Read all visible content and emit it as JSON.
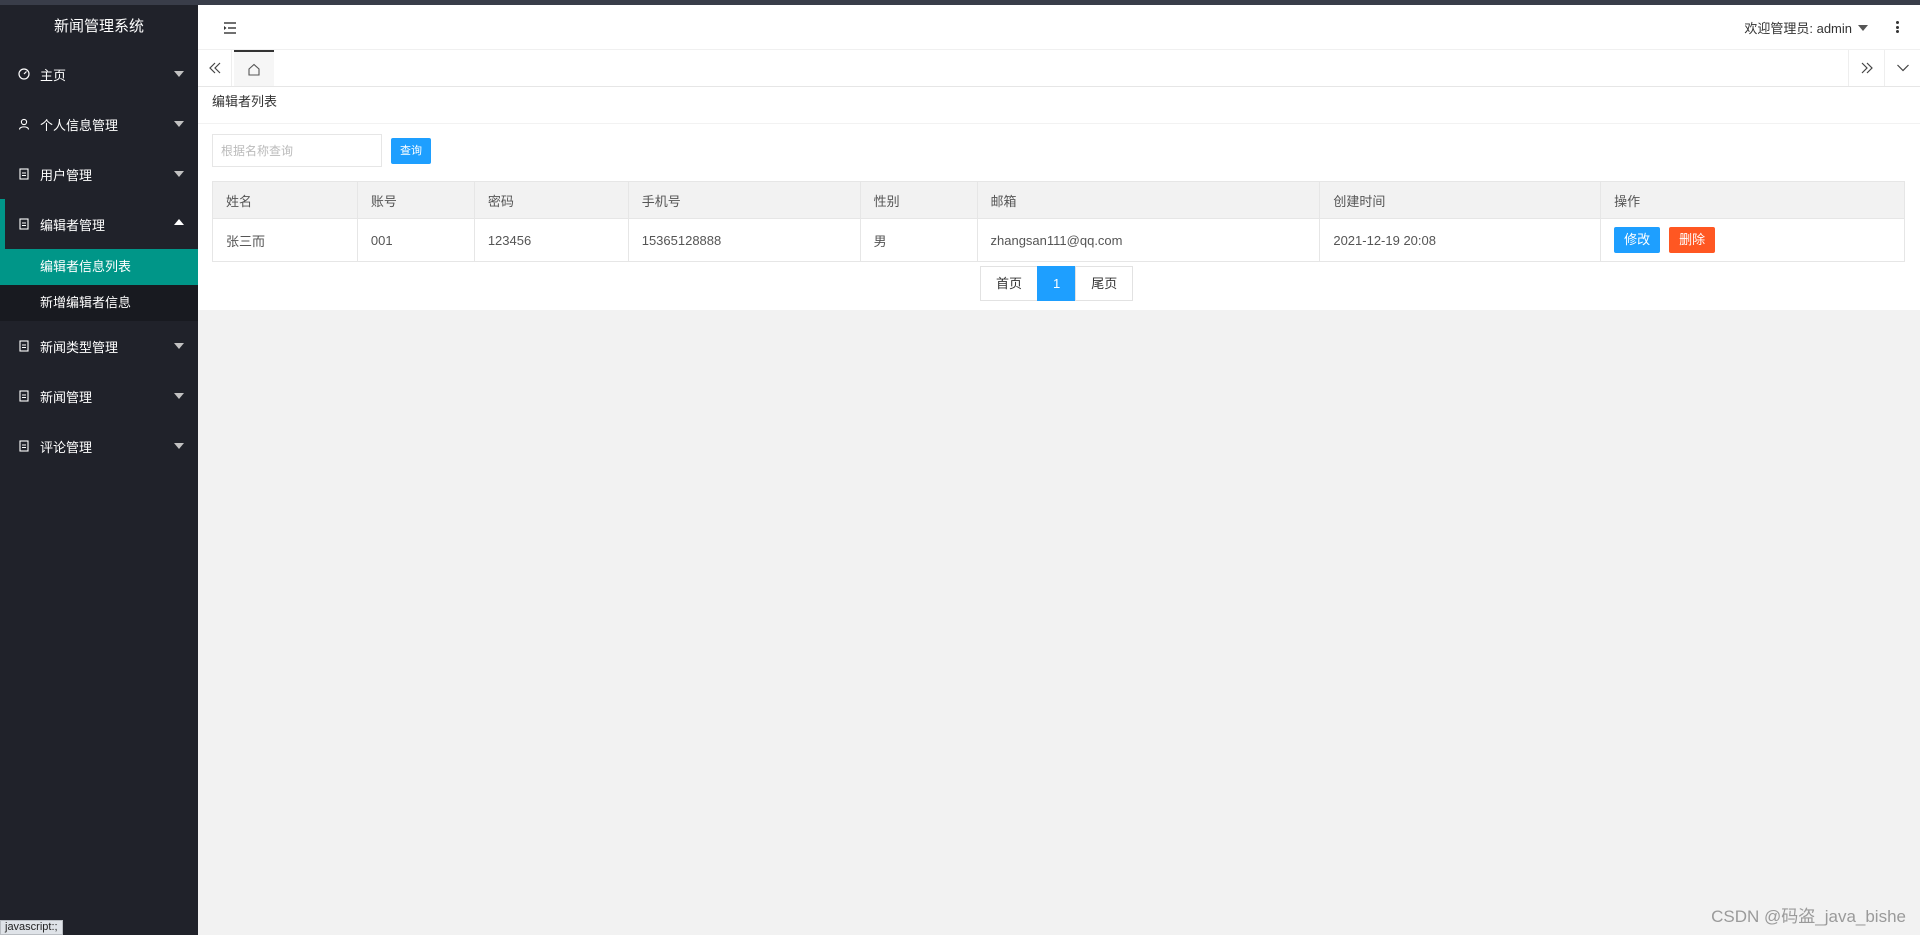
{
  "app": {
    "title": "新闻管理系统"
  },
  "sidebar": {
    "items": [
      {
        "label": "主页",
        "icon": "dashboard-icon"
      },
      {
        "label": "个人信息管理",
        "icon": "user-icon"
      },
      {
        "label": "用户管理",
        "icon": "file-icon"
      },
      {
        "label": "编辑者管理",
        "icon": "file-icon",
        "expanded": true,
        "children": [
          {
            "label": "编辑者信息列表",
            "active": true
          },
          {
            "label": "新增编辑者信息",
            "active": false
          }
        ]
      },
      {
        "label": "新闻类型管理",
        "icon": "file-icon"
      },
      {
        "label": "新闻管理",
        "icon": "file-icon"
      },
      {
        "label": "评论管理",
        "icon": "file-icon"
      }
    ]
  },
  "header": {
    "user_label": "欢迎管理员: admin"
  },
  "page": {
    "title": "编辑者列表"
  },
  "search": {
    "placeholder": "根据名称查询",
    "button_label": "查询"
  },
  "table": {
    "columns": [
      "姓名",
      "账号",
      "密码",
      "手机号",
      "性别",
      "邮箱",
      "创建时间",
      "操作"
    ],
    "rows": [
      {
        "name": "张三而",
        "account": "001",
        "password": "123456",
        "phone": "15365128888",
        "gender": "男",
        "email": "zhangsan111@qq.com",
        "created": "2021-12-19 20:08",
        "edit_label": "修改",
        "delete_label": "删除"
      }
    ]
  },
  "pager": {
    "first": "首页",
    "current": "1",
    "last": "尾页"
  },
  "status_bar": {
    "text": "javascript:;"
  },
  "watermark": {
    "text": "CSDN @码盗_java_bishe"
  },
  "colors": {
    "sidebar_bg": "#20222a",
    "accent": "#009688",
    "primary": "#1e9fff",
    "danger": "#ff5722"
  }
}
